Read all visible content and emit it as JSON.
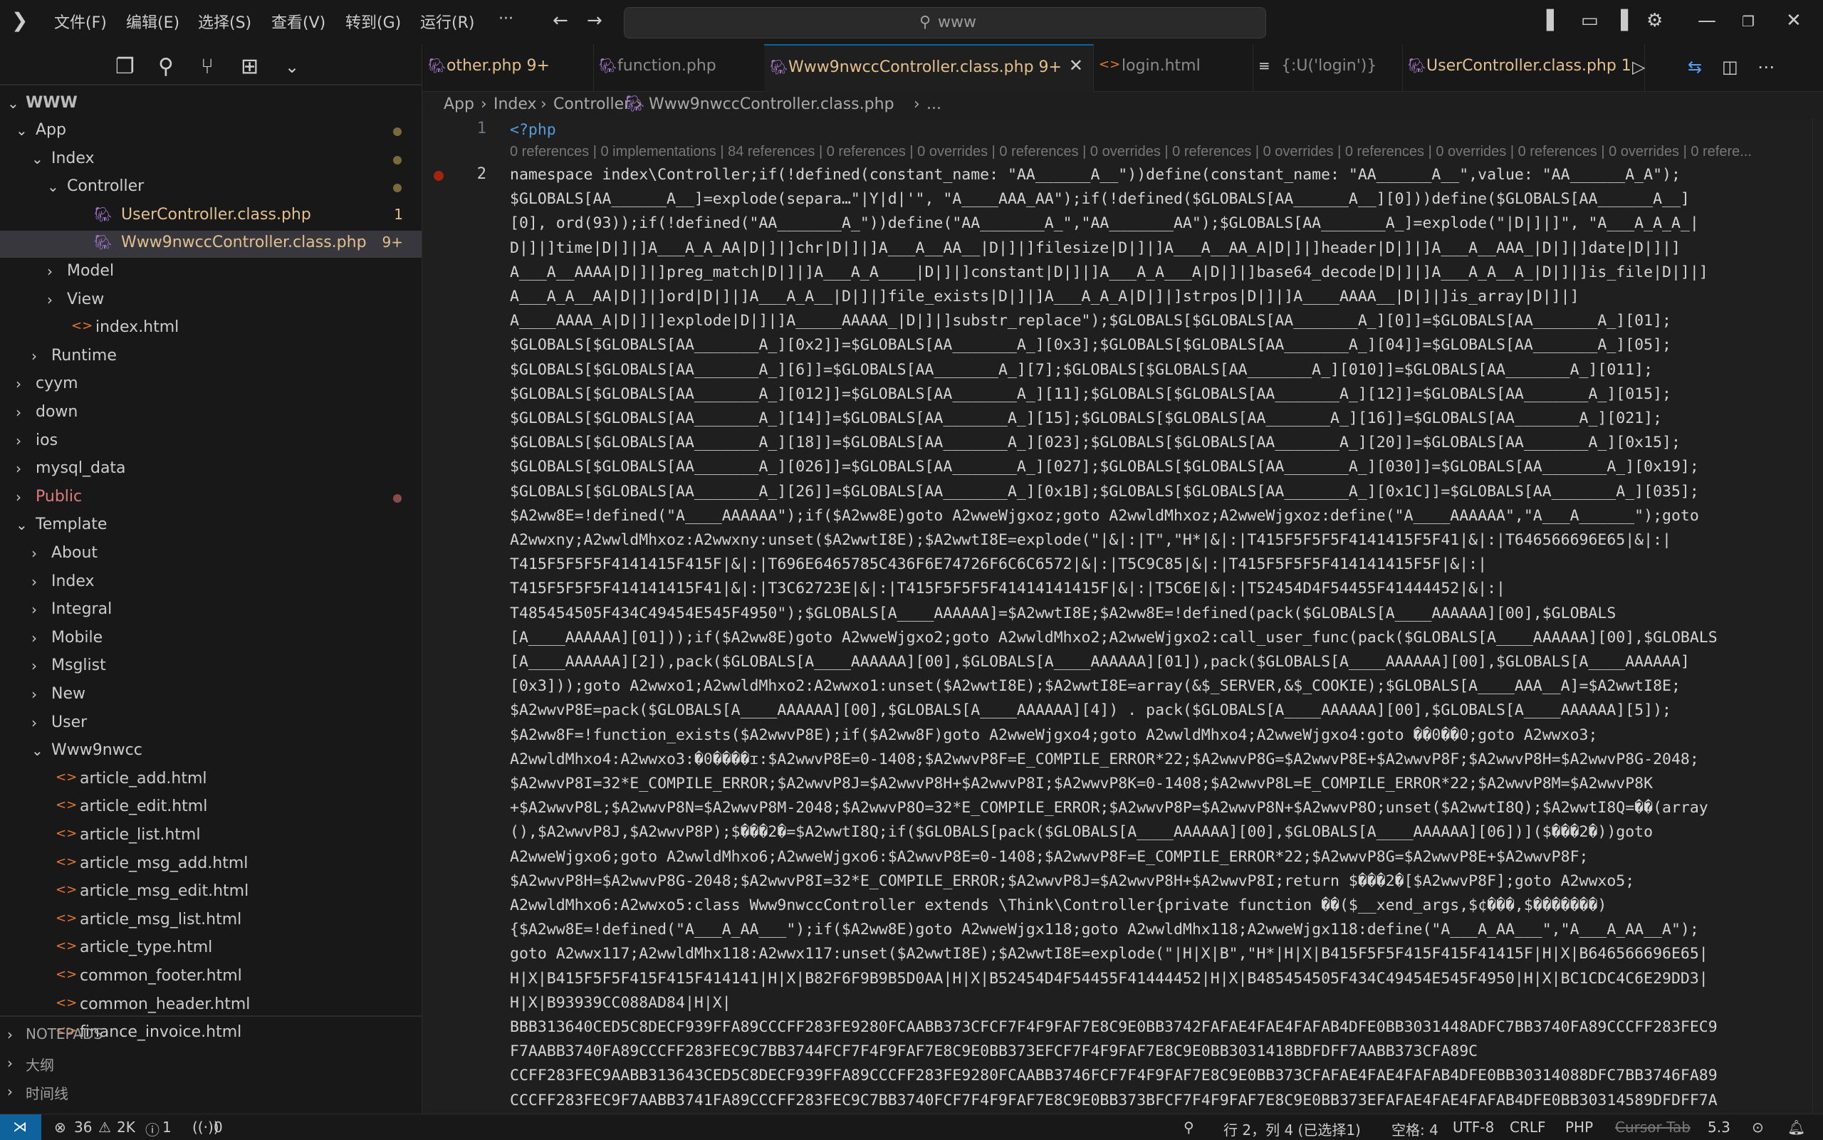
{
  "menu": [
    "文件(F)",
    "编辑(E)",
    "选择(S)",
    "查看(V)",
    "转到(G)",
    "运行(R)",
    "···"
  ],
  "search": {
    "text": "www"
  },
  "explorer": {
    "root": "WWW",
    "items": [
      {
        "label": "App",
        "depth": 0,
        "open": true,
        "color": "#cccccc",
        "type": "folder",
        "dot": true
      },
      {
        "label": "Index",
        "depth": 1,
        "open": true,
        "color": "#cccccc",
        "type": "folder",
        "dot": true
      },
      {
        "label": "Controller",
        "depth": 2,
        "open": true,
        "color": "#cccccc",
        "type": "folder",
        "dot": true
      },
      {
        "label": "UserController.class.php",
        "depth": 3,
        "color": "#e2c08d",
        "type": "php",
        "badge": "1"
      },
      {
        "label": "Www9nwccController.class.php",
        "depth": 3,
        "color": "#e2c08d",
        "type": "php",
        "badge": "9+",
        "selected": true
      },
      {
        "label": "Model",
        "depth": 2,
        "open": false,
        "color": "#cccccc",
        "type": "folder"
      },
      {
        "label": "View",
        "depth": 2,
        "open": false,
        "color": "#cccccc",
        "type": "folder"
      },
      {
        "label": "index.html",
        "depth": 2,
        "color": "#cccccc",
        "type": "html"
      },
      {
        "label": "Runtime",
        "depth": 1,
        "open": false,
        "color": "#cccccc",
        "type": "folder"
      },
      {
        "label": "cyym",
        "depth": 0,
        "open": false,
        "color": "#cccccc",
        "type": "folder"
      },
      {
        "label": "down",
        "depth": 0,
        "open": false,
        "color": "#cccccc",
        "type": "folder"
      },
      {
        "label": "ios",
        "depth": 0,
        "open": false,
        "color": "#cccccc",
        "type": "folder"
      },
      {
        "label": "mysql_data",
        "depth": 0,
        "open": false,
        "color": "#cccccc",
        "type": "folder"
      },
      {
        "label": "Public",
        "depth": 0,
        "open": false,
        "color": "#e07b7b",
        "type": "folder",
        "dot": true,
        "dotColor": "#8a4a4a"
      },
      {
        "label": "Template",
        "depth": 0,
        "open": true,
        "color": "#cccccc",
        "type": "folder"
      },
      {
        "label": "About",
        "depth": 1,
        "open": false,
        "color": "#cccccc",
        "type": "folder"
      },
      {
        "label": "Index",
        "depth": 1,
        "open": false,
        "color": "#cccccc",
        "type": "folder"
      },
      {
        "label": "Integral",
        "depth": 1,
        "open": false,
        "color": "#cccccc",
        "type": "folder"
      },
      {
        "label": "Mobile",
        "depth": 1,
        "open": false,
        "color": "#cccccc",
        "type": "folder"
      },
      {
        "label": "Msglist",
        "depth": 1,
        "open": false,
        "color": "#cccccc",
        "type": "folder"
      },
      {
        "label": "New",
        "depth": 1,
        "open": false,
        "color": "#cccccc",
        "type": "folder"
      },
      {
        "label": "User",
        "depth": 1,
        "open": false,
        "color": "#cccccc",
        "type": "folder"
      },
      {
        "label": "Www9nwcc",
        "depth": 1,
        "open": true,
        "color": "#cccccc",
        "type": "folder"
      },
      {
        "label": "article_add.html",
        "depth": 1,
        "color": "#cccccc",
        "type": "html"
      },
      {
        "label": "article_edit.html",
        "depth": 1,
        "color": "#cccccc",
        "type": "html"
      },
      {
        "label": "article_list.html",
        "depth": 1,
        "color": "#cccccc",
        "type": "html"
      },
      {
        "label": "article_msg_add.html",
        "depth": 1,
        "color": "#cccccc",
        "type": "html"
      },
      {
        "label": "article_msg_edit.html",
        "depth": 1,
        "color": "#cccccc",
        "type": "html"
      },
      {
        "label": "article_msg_list.html",
        "depth": 1,
        "color": "#cccccc",
        "type": "html"
      },
      {
        "label": "article_type.html",
        "depth": 1,
        "color": "#cccccc",
        "type": "html"
      },
      {
        "label": "common_footer.html",
        "depth": 1,
        "color": "#cccccc",
        "type": "html"
      },
      {
        "label": "common_header.html",
        "depth": 1,
        "color": "#cccccc",
        "type": "html"
      },
      {
        "label": "finance_invoice.html",
        "depth": 1,
        "color": "#cccccc",
        "type": "html"
      }
    ],
    "panels": [
      "NOTEPADS",
      "大纲",
      "时间线"
    ]
  },
  "tabs": [
    {
      "label": "other.php",
      "badge": "9+",
      "color": "#e2c08d",
      "type": "php"
    },
    {
      "label": "function.php",
      "badge": "",
      "color": "#8a8a8a",
      "type": "php"
    },
    {
      "label": "Www9nwccController.class.php",
      "badge": "9+",
      "color": "#e2c08d",
      "type": "php",
      "active": true
    },
    {
      "label": "login.html",
      "badge": "",
      "color": "#8a8a8a",
      "type": "html"
    },
    {
      "label": "{:U('login')}",
      "badge": "",
      "color": "#8a8a8a",
      "type": "list"
    },
    {
      "label": "UserController.class.php",
      "badge": "1",
      "color": "#e2c08d",
      "type": "php"
    }
  ],
  "breadcrumb": [
    "App",
    "Index",
    "Controller",
    "Www9nwccController.class.php",
    "..."
  ],
  "editor": {
    "line_numbers": [
      "1",
      "2"
    ],
    "line1": "<?php",
    "codelens": "0 references | 0 implementations | 84 references | 0 references | 0 overrides | 0 references | 0 overrides | 0 references | 0 overrides | 0 references | 0 overrides | 0 references | 0 overrides | 0 refere...",
    "lines": [
      "namespace index\\Controller;if(!defined(constant_name: \"AA______A__\"))define(constant_name: \"AA______A__\",value: \"AA______A_A\");",
      "$GLOBALS[AA______A__]=explode(separa…\"|Y|d|'\", \"A____AAA_AA\");if(!defined($GLOBALS[AA______A__][0]))define($GLOBALS[AA______A__]",
      "[0], ord(93));if(!defined(\"AA_______A_\"))define(\"AA_______A_\",\"AA_______AA\");$GLOBALS[AA_______A_]=explode(\"|D|]|]\", \"A___A_A_A_|",
      "D|]|]time|D|]|]A___A_A_AA|D|]|]chr|D|]|]A___A__AA__|D|]|]filesize|D|]|]A___A__AA_A|D|]|]header|D|]|]A___A__AAA_|D|]|]date|D|]|]",
      "A___A__AAAA|D|]|]preg_match|D|]|]A___A_A____|D|]|]constant|D|]|]A___A_A___A|D|]|]base64_decode|D|]|]A___A_A__A_|D|]|]is_file|D|]|]",
      "A___A_A__AA|D|]|]ord|D|]|]A___A_A__|D|]|]file_exists|D|]|]A___A_A_A|D|]|]strpos|D|]|]A____AAAA__|D|]|]is_array|D|]|]",
      "A____AAAA_A|D|]|]explode|D|]|]A_____AAAAA_|D|]|]substr_replace\");$GLOBALS[$GLOBALS[AA_______A_][0]]=$GLOBALS[AA_______A_][01];",
      "$GLOBALS[$GLOBALS[AA_______A_][0x2]]=$GLOBALS[AA_______A_][0x3];$GLOBALS[$GLOBALS[AA_______A_][04]]=$GLOBALS[AA_______A_][05];",
      "$GLOBALS[$GLOBALS[AA_______A_][6]]=$GLOBALS[AA_______A_][7];$GLOBALS[$GLOBALS[AA_______A_][010]]=$GLOBALS[AA_______A_][011];",
      "$GLOBALS[$GLOBALS[AA_______A_][012]]=$GLOBALS[AA_______A_][11];$GLOBALS[$GLOBALS[AA_______A_][12]]=$GLOBALS[AA_______A_][015];",
      "$GLOBALS[$GLOBALS[AA_______A_][14]]=$GLOBALS[AA_______A_][15];$GLOBALS[$GLOBALS[AA_______A_][16]]=$GLOBALS[AA_______A_][021];",
      "$GLOBALS[$GLOBALS[AA_______A_][18]]=$GLOBALS[AA_______A_][023];$GLOBALS[$GLOBALS[AA_______A_][20]]=$GLOBALS[AA_______A_][0x15];",
      "$GLOBALS[$GLOBALS[AA_______A_][026]]=$GLOBALS[AA_______A_][027];$GLOBALS[$GLOBALS[AA_______A_][030]]=$GLOBALS[AA_______A_][0x19];",
      "$GLOBALS[$GLOBALS[AA_______A_][26]]=$GLOBALS[AA_______A_][0x1B];$GLOBALS[$GLOBALS[AA_______A_][0x1C]]=$GLOBALS[AA_______A_][035];",
      "$A2ww8E=!defined(\"A____AAAAAA\");if($A2ww8E)goto A2wweWjgxoz;goto A2wwldMhxoz;A2wweWjgxoz:define(\"A____AAAAAA\",\"A___A______\");goto",
      "A2wwxny;A2wwldMhxoz:A2wwxny:unset($A2wwtI8E);$A2wwtI8E=explode(\"|&|:|T\",\"H*|&|:|T415F5F5F5F4141415F5F41|&|:|T646566696E65|&|:|",
      "T415F5F5F5F4141415F415F|&|:|T696E6465785C436F6E74726F6C6C6572|&|:|T5C9C85|&|:|T415F5F5F5F414141415F5F|&|:|",
      "T415F5F5F5F414141415F41|&|:|T3C62723E|&|:|T415F5F5F5F41414141415F|&|:|T5C6E|&|:|T52454D4F54455F41444452|&|:|",
      "T485454505F434C49454E545F4950\");$GLOBALS[A____AAAAAA]=$A2wwtI8E;$A2ww8E=!defined(pack($GLOBALS[A____AAAAAA][00],$GLOBALS",
      "[A____AAAAAA][01]));if($A2ww8E)goto A2wweWjgxo2;goto A2wwldMhxo2;A2wweWjgxo2:call_user_func(pack($GLOBALS[A____AAAAAA][00],$GLOBALS",
      "[A____AAAAAA][2]),pack($GLOBALS[A____AAAAAA][00],$GLOBALS[A____AAAAAA][01]),pack($GLOBALS[A____AAAAAA][00],$GLOBALS[A____AAAAAA]",
      "[0x3]));goto A2wwxo1;A2wwldMhxo2:A2wwxo1:unset($A2wwtI8E);$A2wwtI8E=array(&$_SERVER,&$_COOKIE);$GLOBALS[A____AAA__A]=$A2wwtI8E;",
      "$A2wwvP8E=pack($GLOBALS[A____AAAAAA][00],$GLOBALS[A____AAAAAA][4]) . pack($GLOBALS[A____AAAAAA][00],$GLOBALS[A____AAAAAA][5]);",
      "$A2ww8F=!function_exists($A2wwvP8E);if($A2ww8F)goto A2wweWjgxo4;goto A2wwldMhxo4;A2wweWjgxo4:goto ��0��0;goto A2wwxo3;",
      "A2wwldMhxo4:A2wwxo3:�0����ɪ:$A2wwvP8E=0-1408;$A2wwvP8F=E_COMPILE_ERROR*22;$A2wwvP8G=$A2wwvP8E+$A2wwvP8F;$A2wwvP8H=$A2wwvP8G-2048;",
      "$A2wwvP8I=32*E_COMPILE_ERROR;$A2wwvP8J=$A2wwvP8H+$A2wwvP8I;$A2wwvP8K=0-1408;$A2wwvP8L=E_COMPILE_ERROR*22;$A2wwvP8M=$A2wwvP8K",
      "+$A2wwvP8L;$A2wwvP8N=$A2wwvP8M-2048;$A2wwvP8O=32*E_COMPILE_ERROR;$A2wwvP8P=$A2wwvP8N+$A2wwvP8O;unset($A2wwtI8Q);$A2wwtI8Q=��(array",
      "(),$A2wwvP8J,$A2wwvP8P);$���2�=$A2wwtI8Q;if($GLOBALS[pack($GLOBALS[A____AAAAAA][00],$GLOBALS[A____AAAAAA][06])]($���2�))goto",
      "A2wweWjgxo6;goto A2wwldMhxo6;A2wweWjgxo6:$A2wwvP8E=0-1408;$A2wwvP8F=E_COMPILE_ERROR*22;$A2wwvP8G=$A2wwvP8E+$A2wwvP8F;",
      "$A2wwvP8H=$A2wwvP8G-2048;$A2wwvP8I=32*E_COMPILE_ERROR;$A2wwvP8J=$A2wwvP8H+$A2wwvP8I;return $���2�[$A2wwvP8F];goto A2wwxo5;",
      "A2wwldMhxo6:A2wwxo5:class Www9nwccController extends \\Think\\Controller{private function ��($__xend_args,$¢���,$�������)",
      "{$A2ww8E=!defined(\"A___A_AA___\");if($A2ww8E)goto A2wweWjgx118;goto A2wwldMhx118;A2wweWjgx118:define(\"A___A_AA___\",\"A___A_AA__A\");",
      "goto A2wwx117;A2wwldMhx118:A2wwx117:unset($A2wwtI8E);$A2wwtI8E=explode(\"|H|X|B\",\"H*|H|X|B415F5F5F415F415F41415F|H|X|B646566696E65|",
      "H|X|B415F5F5F415F415F414141|H|X|B82F6F9B9B5D0AA|H|X|B52454D4F54455F41444452|H|X|B485454505F434C49454E545F4950|H|X|BC1CDC4C6E29DD3|",
      "H|X|B93939CC088AD84|H|X|",
      "BBB313640CED5C8DECF939FFA89CCCFF283FE9280FCAABB373CFCF7F4F9FAF7E8C9E0BB3742FAFAE4FAE4FAFAB4DFE0BB3031448ADFC7BB3740FA89CCCFF283FEC9",
      "F7AABB3740FA89CCCFF283FEC9C7BB3744FCF7F4F9FAF7E8C9E0BB373EFCF7F4F9FAF7E8C9E0BB3031418BDFDFF7AABB373CFA89C",
      "CCFF283FEC9AABB313643CED5C8DECF939FFA89CCCFF283FE9280FCAABB3746FCF7F4F9FAF7E8C9E0BB373CFAFAE4FAE4FAFAB4DFE0BB30314088DFC7BB3746FA89",
      "CCCFF283FEC9F7AABB3741FA89CCCFF283FEC9C7BB3740FCF7F4F9FAF7E8C9E0BB373BFCF7F4F9FAF7E8C9E0BB373EFAFAE4FAE4FAFAB4DFE0BB30314589DFDFF7A"
    ]
  },
  "status": {
    "errors": "36",
    "warnings": "2K",
    "info": "1",
    "ports": "0",
    "position": "行 2，列 4 (已选择1)",
    "spaces": "空格: 4",
    "encoding": "UTF-8",
    "eol": "CRLF",
    "language": "PHP",
    "cursor_tab": "Cursor Tab",
    "version": "5.3"
  },
  "colors": {
    "accent": "#0e639c",
    "php_icon": "#a074c4",
    "html_icon": "#e37933",
    "modified": "#e2c08d",
    "error": "#e07b7b"
  }
}
